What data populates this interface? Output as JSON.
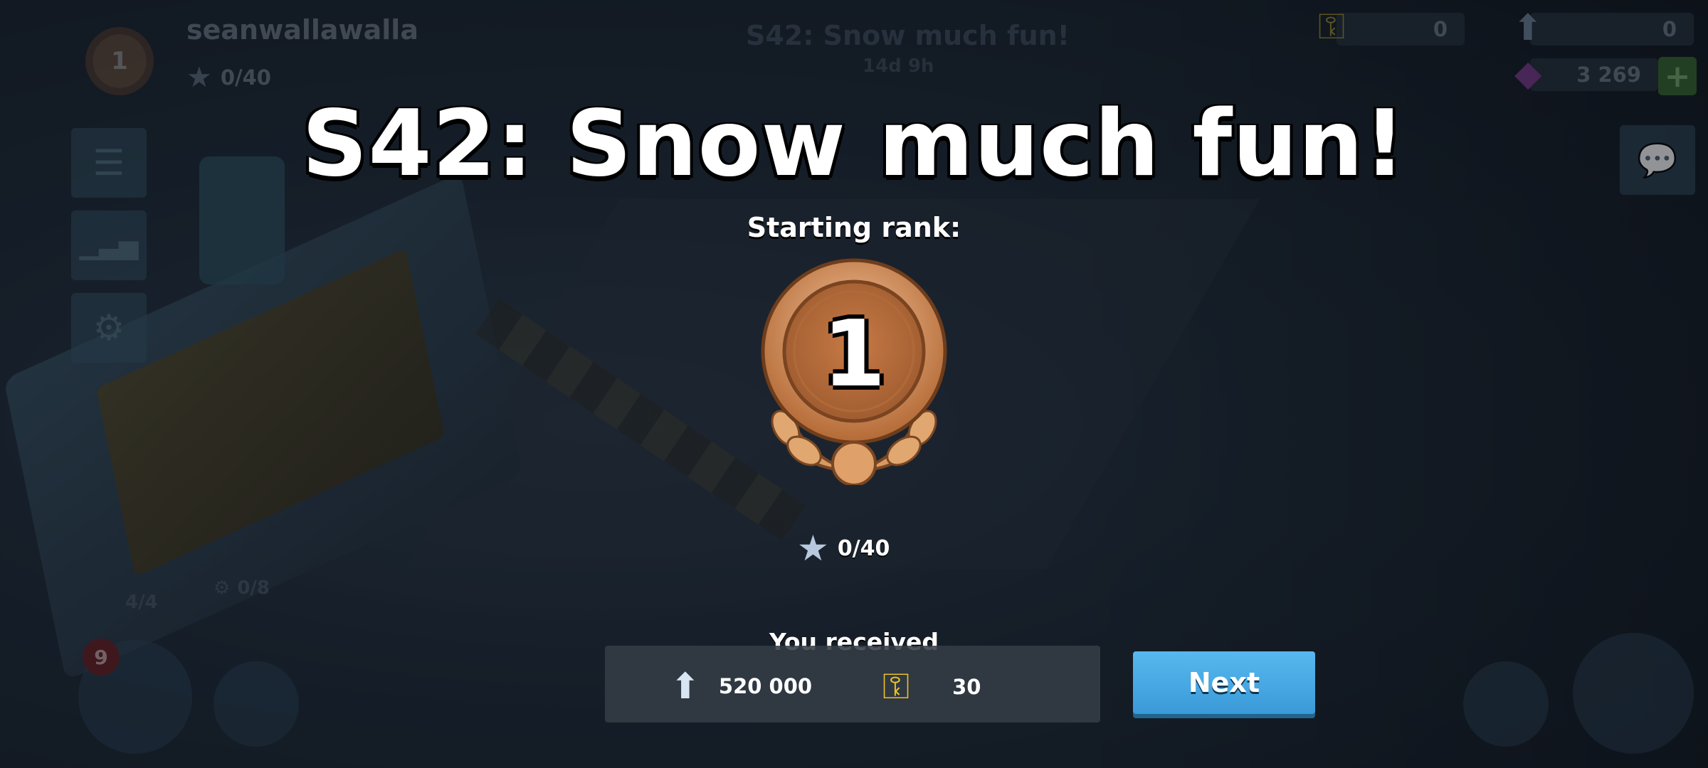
{
  "hud": {
    "player_name": "seanwallawalla",
    "rank": "1",
    "stars": "0/40",
    "season_title": "S42: Snow much fun!",
    "season_time": "14d 9h",
    "keys": "0",
    "intel": "0",
    "diamonds": "3 269",
    "plus": "+",
    "chest_count": "4/4",
    "parts_count": "0/8",
    "notification_badge": "9"
  },
  "modal": {
    "title": "S42: Snow much fun!",
    "starting_rank_label": "Starting rank:",
    "rank_number": "1",
    "stars": "0/40",
    "received_label": "You received",
    "rewards": [
      {
        "icon": "intel-icon",
        "value": "520 000"
      },
      {
        "icon": "key-icon",
        "value": "30"
      }
    ],
    "next_label": "Next"
  },
  "colors": {
    "medal_bronze": "#d08a55",
    "next_button": "#49aae4",
    "key_gold": "#e8c12a",
    "gem_purple": "#b04fd6"
  }
}
